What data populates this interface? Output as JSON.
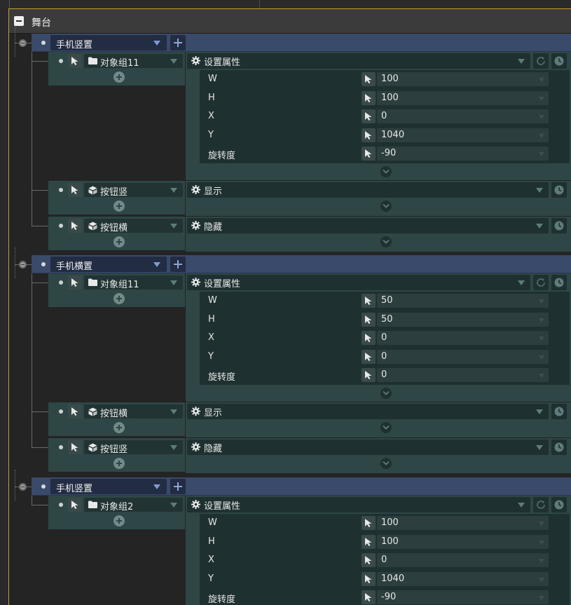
{
  "panel": {
    "title": "舞台"
  },
  "events": [
    {
      "label": "手机竖置",
      "rows": [
        {
          "object": {
            "label": "对象组11",
            "icon": "folder-icon"
          },
          "action": {
            "label": "设置属性",
            "has_refresh": true
          },
          "props": [
            {
              "label": "W",
              "value": "100"
            },
            {
              "label": "H",
              "value": "100"
            },
            {
              "label": "X",
              "value": "0"
            },
            {
              "label": "Y",
              "value": "1040"
            },
            {
              "label": "旋转度",
              "value": "-90"
            }
          ]
        },
        {
          "object": {
            "label": "按钮竖",
            "icon": "cube-icon"
          },
          "action": {
            "label": "显示",
            "has_refresh": false
          }
        },
        {
          "object": {
            "label": "按钮横",
            "icon": "cube-icon"
          },
          "action": {
            "label": "隐藏",
            "has_refresh": false
          }
        }
      ]
    },
    {
      "label": "手机横置",
      "rows": [
        {
          "object": {
            "label": "对象组11",
            "icon": "folder-icon"
          },
          "action": {
            "label": "设置属性",
            "has_refresh": true
          },
          "props": [
            {
              "label": "W",
              "value": "50"
            },
            {
              "label": "H",
              "value": "50"
            },
            {
              "label": "X",
              "value": "0"
            },
            {
              "label": "Y",
              "value": "0"
            },
            {
              "label": "旋转度",
              "value": "0"
            }
          ]
        },
        {
          "object": {
            "label": "按钮横",
            "icon": "cube-icon"
          },
          "action": {
            "label": "显示",
            "has_refresh": false
          }
        },
        {
          "object": {
            "label": "按钮竖",
            "icon": "cube-icon"
          },
          "action": {
            "label": "隐藏",
            "has_refresh": false
          }
        }
      ]
    },
    {
      "label": "手机竖置",
      "rows": [
        {
          "object": {
            "label": "对象组2",
            "icon": "folder-icon"
          },
          "action": {
            "label": "设置属性",
            "has_refresh": true
          },
          "props": [
            {
              "label": "W",
              "value": "100"
            },
            {
              "label": "H",
              "value": "100"
            },
            {
              "label": "X",
              "value": "0"
            },
            {
              "label": "Y",
              "value": "1040"
            },
            {
              "label": "旋转度",
              "value": "-90"
            }
          ]
        }
      ]
    }
  ]
}
